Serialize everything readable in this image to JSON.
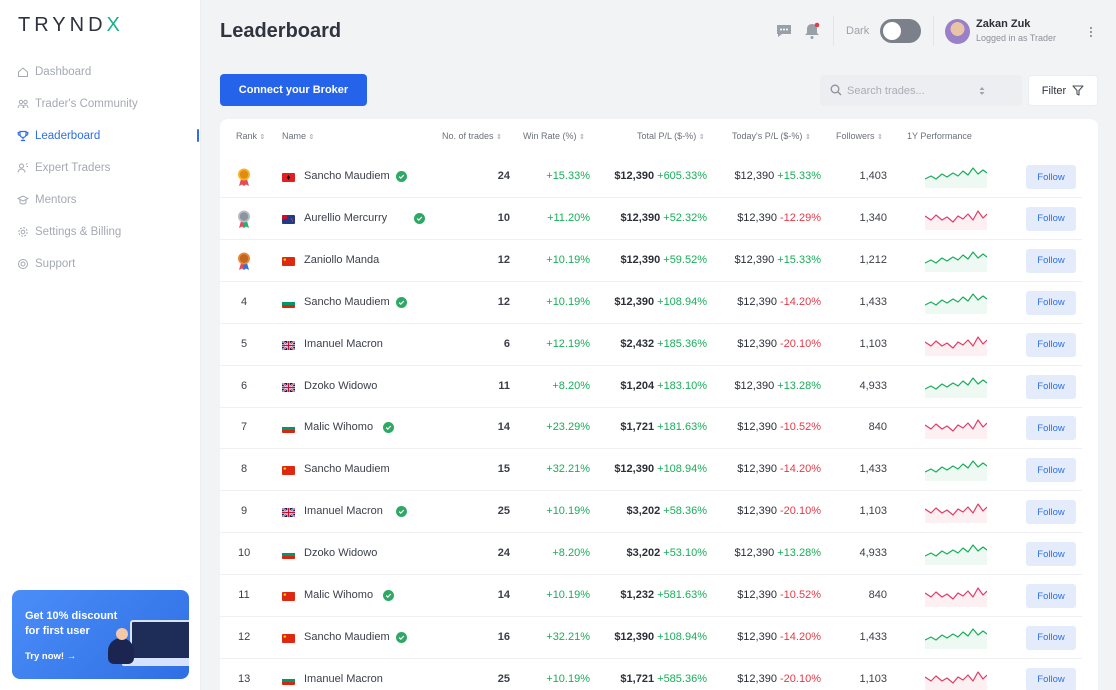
{
  "app": {
    "logo": "TRYNDX"
  },
  "sidebar": {
    "items": [
      {
        "label": "Dashboard",
        "icon": "home-icon"
      },
      {
        "label": "Trader's Community",
        "icon": "community-icon"
      },
      {
        "label": "Leaderboard",
        "icon": "trophy-icon",
        "active": true
      },
      {
        "label": "Expert Traders",
        "icon": "expert-icon"
      },
      {
        "label": "Mentors",
        "icon": "mentor-icon"
      },
      {
        "label": "Settings & Billing",
        "icon": "gear-icon"
      },
      {
        "label": "Support",
        "icon": "support-icon"
      }
    ],
    "promo": {
      "title": "Get 10% discount for first user",
      "cta": "Try now! →"
    }
  },
  "header": {
    "title": "Leaderboard",
    "dark_label": "Dark",
    "user": {
      "name": "Zakan Zuk",
      "role": "Logged in as Trader"
    }
  },
  "toolbar": {
    "connect_label": "Connect your Broker",
    "search_placeholder": "Search trades...",
    "filter_label": "Filter"
  },
  "table": {
    "columns": [
      "Rank",
      "Name",
      "No. of trades",
      "Win Rate (%)",
      "Total P/L ($-%)",
      "Today's P/L ($-%)",
      "Followers",
      "1Y Performance"
    ],
    "follow_label": "Follow",
    "rows": [
      {
        "rank": "1",
        "medal": "gold",
        "flag": "albania",
        "name": "Sancho Maudiem",
        "verified": true,
        "trades": "24",
        "win_rate": "+15.33%",
        "total_amt": "$12,390",
        "total_pct": "+605.33%",
        "today_amt": "$12,390",
        "today_pct": "+15.33%",
        "followers": "1,403",
        "trend": "up"
      },
      {
        "rank": "2",
        "medal": "silver",
        "flag": "new-zealand",
        "name": "Aurellio Mercurry",
        "verified": true,
        "trades": "10",
        "win_rate": "+11.20%",
        "total_amt": "$12,390",
        "total_pct": "+52.32%",
        "today_amt": "$12,390",
        "today_pct": "-12.29%",
        "followers": "1,340",
        "trend": "down"
      },
      {
        "rank": "3",
        "medal": "bronze",
        "flag": "china",
        "name": "Zaniollo Manda",
        "verified": false,
        "trades": "12",
        "win_rate": "+10.19%",
        "total_amt": "$12,390",
        "total_pct": "+59.52%",
        "today_amt": "$12,390",
        "today_pct": "+15.33%",
        "followers": "1,212",
        "trend": "up"
      },
      {
        "rank": "4",
        "medal": "",
        "flag": "bulgaria",
        "name": "Sancho Maudiem",
        "verified": true,
        "trades": "12",
        "win_rate": "+10.19%",
        "total_amt": "$12,390",
        "total_pct": "+108.94%",
        "today_amt": "$12,390",
        "today_pct": "-14.20%",
        "followers": "1,433",
        "trend": "up"
      },
      {
        "rank": "5",
        "medal": "",
        "flag": "uk",
        "name": "Imanuel Macron",
        "verified": false,
        "trades": "6",
        "win_rate": "+12.19%",
        "total_amt": "$2,432",
        "total_pct": "+185.36%",
        "today_amt": "$12,390",
        "today_pct": "-20.10%",
        "followers": "1,103",
        "trend": "down"
      },
      {
        "rank": "6",
        "medal": "",
        "flag": "uk",
        "name": "Dzoko Widowo",
        "verified": false,
        "trades": "11",
        "win_rate": "+8.20%",
        "total_amt": "$1,204",
        "total_pct": "+183.10%",
        "today_amt": "$12,390",
        "today_pct": "+13.28%",
        "followers": "4,933",
        "trend": "up"
      },
      {
        "rank": "7",
        "medal": "",
        "flag": "bulgaria",
        "name": "Malic Wihomo",
        "verified": true,
        "trades": "14",
        "win_rate": "+23.29%",
        "total_amt": "$1,721",
        "total_pct": "+181.63%",
        "today_amt": "$12,390",
        "today_pct": "-10.52%",
        "followers": "840",
        "trend": "down"
      },
      {
        "rank": "8",
        "medal": "",
        "flag": "china",
        "name": "Sancho Maudiem",
        "verified": false,
        "trades": "15",
        "win_rate": "+32.21%",
        "total_amt": "$12,390",
        "total_pct": "+108.94%",
        "today_amt": "$12,390",
        "today_pct": "-14.20%",
        "followers": "1,433",
        "trend": "up"
      },
      {
        "rank": "9",
        "medal": "",
        "flag": "uk",
        "name": "Imanuel Macron",
        "verified": true,
        "trades": "25",
        "win_rate": "+10.19%",
        "total_amt": "$3,202",
        "total_pct": "+58.36%",
        "today_amt": "$12,390",
        "today_pct": "-20.10%",
        "followers": "1,103",
        "trend": "down"
      },
      {
        "rank": "10",
        "medal": "",
        "flag": "bulgaria",
        "name": "Dzoko Widowo",
        "verified": false,
        "trades": "24",
        "win_rate": "+8.20%",
        "total_amt": "$3,202",
        "total_pct": "+53.10%",
        "today_amt": "$12,390",
        "today_pct": "+13.28%",
        "followers": "4,933",
        "trend": "up"
      },
      {
        "rank": "11",
        "medal": "",
        "flag": "china",
        "name": "Malic Wihomo",
        "verified": true,
        "trades": "14",
        "win_rate": "+10.19%",
        "total_amt": "$1,232",
        "total_pct": "+581.63%",
        "today_amt": "$12,390",
        "today_pct": "-10.52%",
        "followers": "840",
        "trend": "down"
      },
      {
        "rank": "12",
        "medal": "",
        "flag": "china",
        "name": "Sancho Maudiem",
        "verified": true,
        "trades": "16",
        "win_rate": "+32.21%",
        "total_amt": "$12,390",
        "total_pct": "+108.94%",
        "today_amt": "$12,390",
        "today_pct": "-14.20%",
        "followers": "1,433",
        "trend": "up"
      },
      {
        "rank": "13",
        "medal": "",
        "flag": "bulgaria",
        "name": "Imanuel Macron",
        "verified": false,
        "trades": "25",
        "win_rate": "+10.19%",
        "total_amt": "$1,721",
        "total_pct": "+585.36%",
        "today_amt": "$12,390",
        "today_pct": "-20.10%",
        "followers": "1,103",
        "trend": "down"
      }
    ]
  },
  "colors": {
    "accent": "#2563eb",
    "positive": "#19ad5a",
    "negative": "#e33a4a"
  }
}
